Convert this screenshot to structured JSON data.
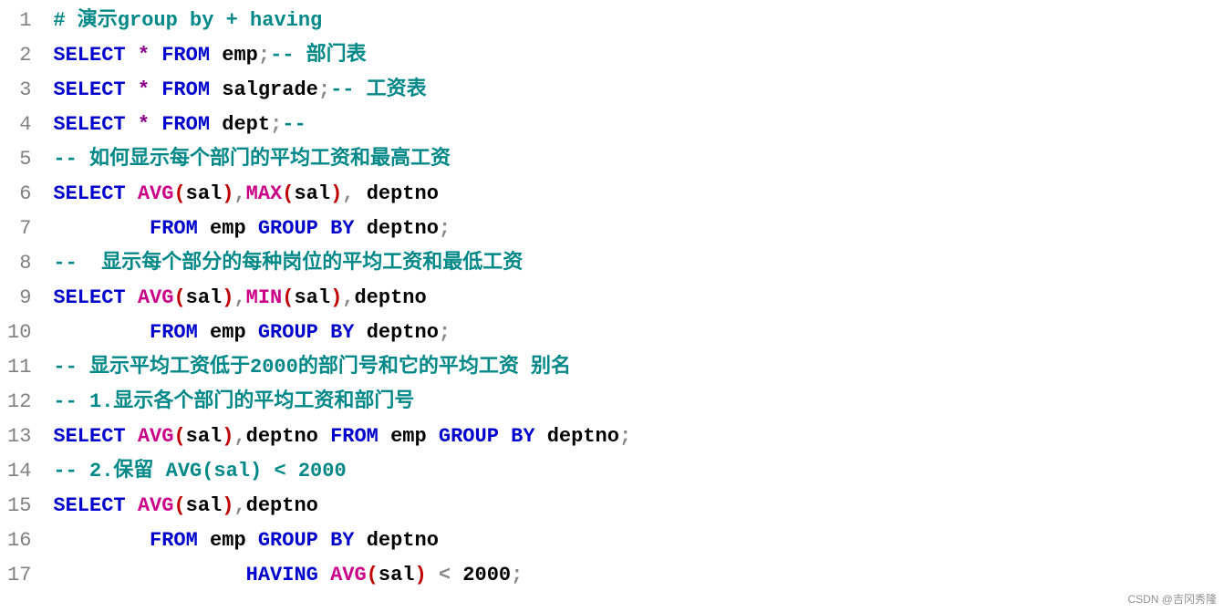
{
  "watermark": "CSDN @吉冈秀隆",
  "code": {
    "lines": [
      {
        "n": 1,
        "t": [
          {
            "c": "c-comment",
            "s": "# 演示group by + having"
          }
        ]
      },
      {
        "n": 2,
        "t": [
          {
            "c": "c-keyword",
            "s": "SELECT"
          },
          {
            "c": "",
            "s": " "
          },
          {
            "c": "c-star",
            "s": "*"
          },
          {
            "c": "",
            "s": " "
          },
          {
            "c": "c-keyword",
            "s": "FROM"
          },
          {
            "c": "",
            "s": " "
          },
          {
            "c": "c-ident",
            "s": "emp"
          },
          {
            "c": "c-op",
            "s": ";"
          },
          {
            "c": "c-comment",
            "s": "-- 部门表"
          }
        ]
      },
      {
        "n": 3,
        "t": [
          {
            "c": "c-keyword",
            "s": "SELECT"
          },
          {
            "c": "",
            "s": " "
          },
          {
            "c": "c-star",
            "s": "*"
          },
          {
            "c": "",
            "s": " "
          },
          {
            "c": "c-keyword",
            "s": "FROM"
          },
          {
            "c": "",
            "s": " "
          },
          {
            "c": "c-ident",
            "s": "salgrade"
          },
          {
            "c": "c-op",
            "s": ";"
          },
          {
            "c": "c-comment",
            "s": "-- 工资表"
          }
        ]
      },
      {
        "n": 4,
        "t": [
          {
            "c": "c-keyword",
            "s": "SELECT"
          },
          {
            "c": "",
            "s": " "
          },
          {
            "c": "c-star",
            "s": "*"
          },
          {
            "c": "",
            "s": " "
          },
          {
            "c": "c-keyword",
            "s": "FROM"
          },
          {
            "c": "",
            "s": " "
          },
          {
            "c": "c-ident",
            "s": "dept"
          },
          {
            "c": "c-op",
            "s": ";"
          },
          {
            "c": "c-comment",
            "s": "--"
          }
        ]
      },
      {
        "n": 5,
        "t": [
          {
            "c": "c-comment",
            "s": "-- 如何显示每个部门的平均工资和最高工资"
          }
        ]
      },
      {
        "n": 6,
        "t": [
          {
            "c": "c-keyword",
            "s": "SELECT"
          },
          {
            "c": "",
            "s": " "
          },
          {
            "c": "c-func",
            "s": "AVG"
          },
          {
            "c": "c-paren",
            "s": "("
          },
          {
            "c": "c-ident",
            "s": "sal"
          },
          {
            "c": "c-paren",
            "s": ")"
          },
          {
            "c": "c-op",
            "s": ","
          },
          {
            "c": "c-func",
            "s": "MAX"
          },
          {
            "c": "c-paren",
            "s": "("
          },
          {
            "c": "c-ident",
            "s": "sal"
          },
          {
            "c": "c-paren",
            "s": ")"
          },
          {
            "c": "c-op",
            "s": ","
          },
          {
            "c": "",
            "s": " "
          },
          {
            "c": "c-ident",
            "s": "deptno"
          }
        ]
      },
      {
        "n": 7,
        "t": [
          {
            "c": "",
            "s": "        "
          },
          {
            "c": "c-keyword",
            "s": "FROM"
          },
          {
            "c": "",
            "s": " "
          },
          {
            "c": "c-ident",
            "s": "emp"
          },
          {
            "c": "",
            "s": " "
          },
          {
            "c": "c-keyword",
            "s": "GROUP"
          },
          {
            "c": "",
            "s": " "
          },
          {
            "c": "c-keyword",
            "s": "BY"
          },
          {
            "c": "",
            "s": " "
          },
          {
            "c": "c-ident",
            "s": "deptno"
          },
          {
            "c": "c-op",
            "s": ";"
          }
        ]
      },
      {
        "n": 8,
        "t": [
          {
            "c": "c-comment",
            "s": "--  显示每个部分的每种岗位的平均工资和最低工资"
          }
        ]
      },
      {
        "n": 9,
        "t": [
          {
            "c": "c-keyword",
            "s": "SELECT"
          },
          {
            "c": "",
            "s": " "
          },
          {
            "c": "c-func",
            "s": "AVG"
          },
          {
            "c": "c-paren",
            "s": "("
          },
          {
            "c": "c-ident",
            "s": "sal"
          },
          {
            "c": "c-paren",
            "s": ")"
          },
          {
            "c": "c-op",
            "s": ","
          },
          {
            "c": "c-func",
            "s": "MIN"
          },
          {
            "c": "c-paren",
            "s": "("
          },
          {
            "c": "c-ident",
            "s": "sal"
          },
          {
            "c": "c-paren",
            "s": ")"
          },
          {
            "c": "c-op",
            "s": ","
          },
          {
            "c": "c-ident",
            "s": "deptno"
          }
        ]
      },
      {
        "n": 10,
        "t": [
          {
            "c": "",
            "s": "        "
          },
          {
            "c": "c-keyword",
            "s": "FROM"
          },
          {
            "c": "",
            "s": " "
          },
          {
            "c": "c-ident",
            "s": "emp"
          },
          {
            "c": "",
            "s": " "
          },
          {
            "c": "c-keyword",
            "s": "GROUP"
          },
          {
            "c": "",
            "s": " "
          },
          {
            "c": "c-keyword",
            "s": "BY"
          },
          {
            "c": "",
            "s": " "
          },
          {
            "c": "c-ident",
            "s": "deptno"
          },
          {
            "c": "c-op",
            "s": ";"
          }
        ]
      },
      {
        "n": 11,
        "t": [
          {
            "c": "c-comment",
            "s": "-- 显示平均工资低于2000的部门号和它的平均工资 别名"
          }
        ]
      },
      {
        "n": 12,
        "t": [
          {
            "c": "c-comment",
            "s": "-- 1.显示各个部门的平均工资和部门号"
          }
        ]
      },
      {
        "n": 13,
        "t": [
          {
            "c": "c-keyword",
            "s": "SELECT"
          },
          {
            "c": "",
            "s": " "
          },
          {
            "c": "c-func",
            "s": "AVG"
          },
          {
            "c": "c-paren",
            "s": "("
          },
          {
            "c": "c-ident",
            "s": "sal"
          },
          {
            "c": "c-paren",
            "s": ")"
          },
          {
            "c": "c-op",
            "s": ","
          },
          {
            "c": "c-ident",
            "s": "deptno"
          },
          {
            "c": "",
            "s": " "
          },
          {
            "c": "c-keyword",
            "s": "FROM"
          },
          {
            "c": "",
            "s": " "
          },
          {
            "c": "c-ident",
            "s": "emp"
          },
          {
            "c": "",
            "s": " "
          },
          {
            "c": "c-keyword",
            "s": "GROUP"
          },
          {
            "c": "",
            "s": " "
          },
          {
            "c": "c-keyword",
            "s": "BY"
          },
          {
            "c": "",
            "s": " "
          },
          {
            "c": "c-ident",
            "s": "deptno"
          },
          {
            "c": "c-op",
            "s": ";"
          }
        ]
      },
      {
        "n": 14,
        "t": [
          {
            "c": "c-comment",
            "s": "-- 2.保留 AVG(sal) < 2000"
          }
        ]
      },
      {
        "n": 15,
        "t": [
          {
            "c": "c-keyword",
            "s": "SELECT"
          },
          {
            "c": "",
            "s": " "
          },
          {
            "c": "c-func",
            "s": "AVG"
          },
          {
            "c": "c-paren",
            "s": "("
          },
          {
            "c": "c-ident",
            "s": "sal"
          },
          {
            "c": "c-paren",
            "s": ")"
          },
          {
            "c": "c-op",
            "s": ","
          },
          {
            "c": "c-ident",
            "s": "deptno"
          }
        ]
      },
      {
        "n": 16,
        "t": [
          {
            "c": "",
            "s": "        "
          },
          {
            "c": "c-keyword",
            "s": "FROM"
          },
          {
            "c": "",
            "s": " "
          },
          {
            "c": "c-ident",
            "s": "emp"
          },
          {
            "c": "",
            "s": " "
          },
          {
            "c": "c-keyword",
            "s": "GROUP"
          },
          {
            "c": "",
            "s": " "
          },
          {
            "c": "c-keyword",
            "s": "BY"
          },
          {
            "c": "",
            "s": " "
          },
          {
            "c": "c-ident",
            "s": "deptno"
          }
        ]
      },
      {
        "n": 17,
        "t": [
          {
            "c": "",
            "s": "                "
          },
          {
            "c": "c-keyword",
            "s": "HAVING"
          },
          {
            "c": "",
            "s": " "
          },
          {
            "c": "c-func",
            "s": "AVG"
          },
          {
            "c": "c-paren",
            "s": "("
          },
          {
            "c": "c-ident",
            "s": "sal"
          },
          {
            "c": "c-paren",
            "s": ")"
          },
          {
            "c": "",
            "s": " "
          },
          {
            "c": "c-op",
            "s": "<"
          },
          {
            "c": "",
            "s": " "
          },
          {
            "c": "c-num",
            "s": "2000"
          },
          {
            "c": "c-op",
            "s": ";"
          }
        ]
      }
    ]
  }
}
